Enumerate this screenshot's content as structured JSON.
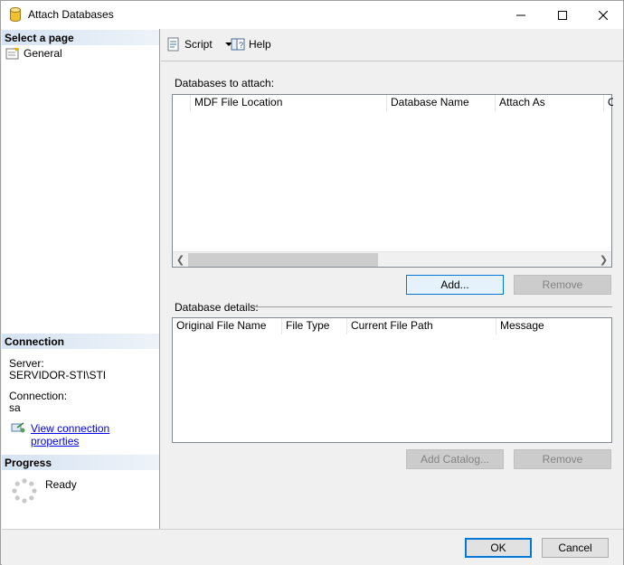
{
  "window": {
    "title": "Attach Databases"
  },
  "left": {
    "select_page_header": "Select a page",
    "pages": [
      {
        "label": "General"
      }
    ],
    "connection_header": "Connection",
    "server_label": "Server:",
    "server_value": "SERVIDOR-STI\\STI",
    "connection_label": "Connection:",
    "connection_value": "sa",
    "view_properties_link": "View connection properties",
    "progress_header": "Progress",
    "progress_status": "Ready"
  },
  "toolbar": {
    "script_label": "Script",
    "help_label": "Help"
  },
  "databases_to_attach": {
    "label": "Databases to attach:",
    "columns": [
      "MDF File Location",
      "Database Name",
      "Attach As",
      "O"
    ],
    "add_button": "Add...",
    "remove_button": "Remove"
  },
  "database_details": {
    "label": "Database details:",
    "columns": [
      "Original File Name",
      "File Type",
      "Current File Path",
      "Message"
    ],
    "add_catalog_button": "Add Catalog...",
    "remove_button": "Remove"
  },
  "footer": {
    "ok_button": "OK",
    "cancel_button": "Cancel"
  }
}
